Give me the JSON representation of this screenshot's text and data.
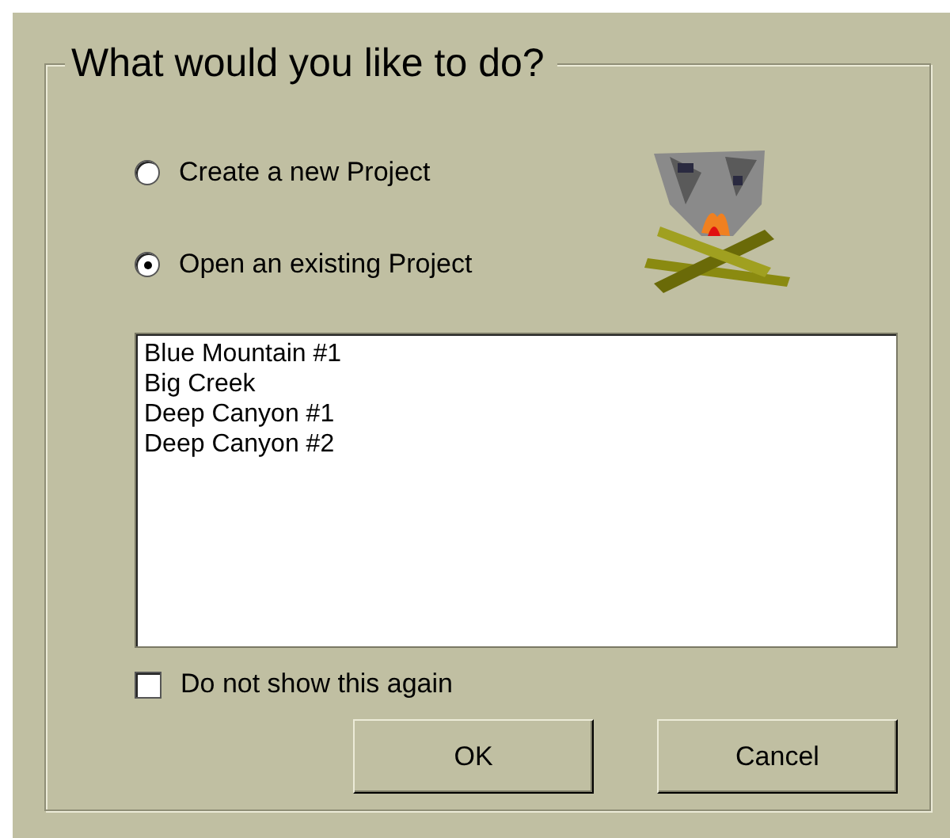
{
  "group_title": "What would you like to do?",
  "options": [
    {
      "label": "Create a new Project",
      "selected": false
    },
    {
      "label": "Open an existing Project",
      "selected": true
    }
  ],
  "projects": [
    {
      "label": "Blue Mountain #1",
      "selected": false
    },
    {
      "label": "Big Creek",
      "selected": false
    },
    {
      "label": "Deep Canyon #1",
      "selected": false
    },
    {
      "label": "Deep Canyon #2",
      "selected": false
    }
  ],
  "dont_show_again": {
    "label": "Do not show this again",
    "checked": false
  },
  "buttons": [
    "OK",
    "Cancel"
  ]
}
